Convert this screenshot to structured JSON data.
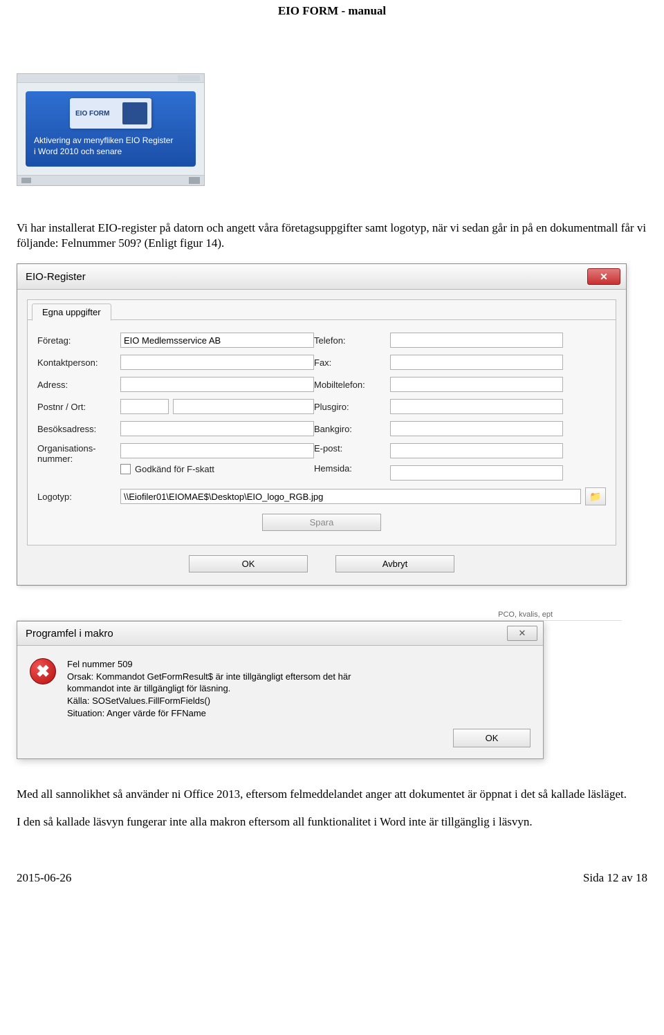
{
  "header": {
    "title": "EIO FORM - manual"
  },
  "footer": {
    "left": "2015-06-26",
    "right": "Sida 12 av 18"
  },
  "thumb": {
    "card_label": "EIO FORM",
    "caption_l1": "Aktivering av menyfliken EIO Register",
    "caption_l2": "i Word 2010 och senare"
  },
  "para1": "Vi har installerat EIO-register på datorn och angett våra företagsuppgifter samt logotyp, när vi sedan går in på en dokumentmall får vi följande: Felnummer 509? (Enligt figur 14).",
  "dialog1": {
    "title": "EIO-Register",
    "tab": "Egna uppgifter",
    "labels": {
      "foretag": "Företag:",
      "kontakt": "Kontaktperson:",
      "adress": "Adress:",
      "postnr": "Postnr / Ort:",
      "besok": "Besöksadress:",
      "orgnr_l1": "Organisations-",
      "orgnr_l2": "nummer:",
      "logotyp": "Logotyp:",
      "telefon": "Telefon:",
      "fax": "Fax:",
      "mobil": "Mobiltelefon:",
      "plusgiro": "Plusgiro:",
      "bankgiro": "Bankgiro:",
      "epost": "E-post:",
      "hemsida": "Hemsida:",
      "fskatt": "Godkänd för F-skatt"
    },
    "values": {
      "foretag": "EIO Medlemsservice AB",
      "logotyp": "\\\\Eiofiler01\\EIOMAE$\\Desktop\\EIO_logo_RGB.jpg"
    },
    "buttons": {
      "spara": "Spara",
      "ok": "OK",
      "avbryt": "Avbryt"
    },
    "browse_icon": "📁"
  },
  "frag_hint": "PCO, kvalis, ept",
  "dialog2": {
    "title": "Programfel i makro",
    "close_glyph": "✕",
    "line1": "Fel nummer  509",
    "line2": "Orsak: Kommandot GetFormResult$ är inte tillgängligt eftersom det här",
    "line3": "kommandot inte är tillgängligt för läsning.",
    "line4": "Källa: SOSetValues.FillFormFields()",
    "line5": "Situation: Anger värde för FFName",
    "ok": "OK"
  },
  "para2": "Med all sannolikhet så använder ni Office 2013, eftersom felmeddelandet anger att dokumentet är öppnat i det så kallade läsläget.",
  "para3": "I den så kallade läsvyn fungerar inte alla makron eftersom all funktionalitet i Word inte är tillgänglig i läsvyn."
}
